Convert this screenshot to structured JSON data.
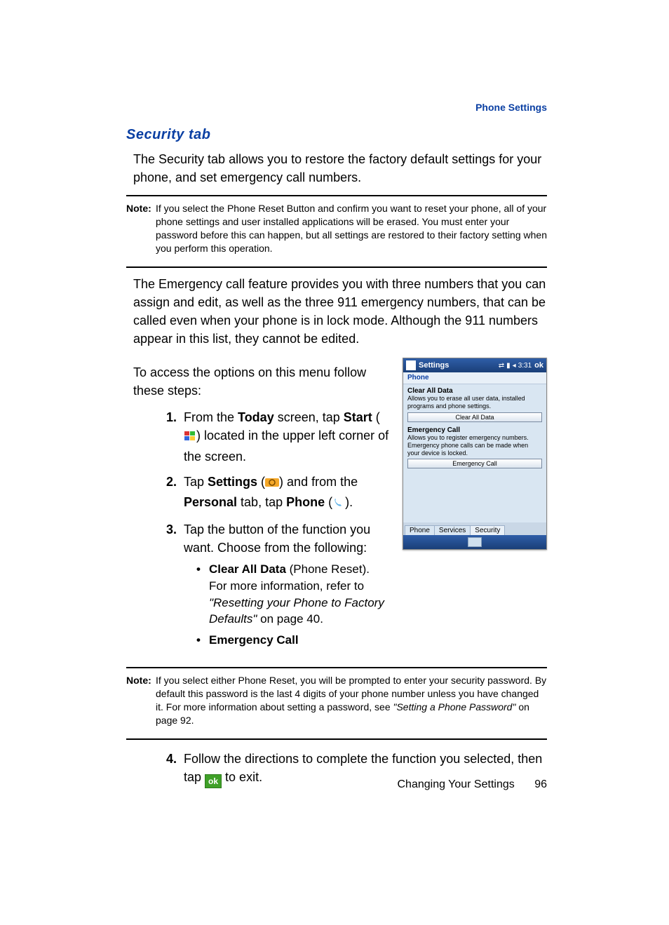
{
  "header": {
    "section": "Phone Settings"
  },
  "heading": "Security tab",
  "intro": "The Security tab allows you to restore the factory default settings for your phone, and set emergency call numbers.",
  "note1": {
    "label": "Note:",
    "text": "If you select the Phone Reset Button and confirm you want to reset your phone, all of your phone settings and user installed applications will be erased. You must enter your password before this can happen, but all settings are restored to their factory setting when you perform this operation."
  },
  "para2": "The Emergency call feature provides you with three numbers that you can assign and edit, as well as the three 911 emergency numbers, that can be called even when your phone is in lock mode. Although the 911 numbers appear in this list, they cannot be edited.",
  "para3": "To access the options on this menu follow these steps:",
  "steps": {
    "s1": {
      "num": "1.",
      "pre": "From the ",
      "b1": "Today",
      "mid1": " screen, tap ",
      "b2": "Start",
      "mid2": " (",
      "post": ") located in the upper left corner of the screen."
    },
    "s2": {
      "num": "2.",
      "pre": "Tap ",
      "b1": "Settings",
      "mid1": " (",
      "mid2": ") and from the ",
      "b2": "Personal",
      "mid3": " tab, tap ",
      "b3": "Phone",
      "mid4": " (",
      "post": ")."
    },
    "s3": {
      "num": "3.",
      "text": "Tap the button of the function you want. Choose from the following:"
    },
    "bullets": {
      "b1": {
        "title": "Clear All Data",
        "after_title": " (Phone Reset). For more information, refer to ",
        "ref": "\"Resetting your Phone to Factory Defaults\"",
        "tail": "  on page 40."
      },
      "b2": {
        "title": "Emergency Call"
      }
    },
    "s4": {
      "num": "4.",
      "pre": "Follow the directions to complete the function you selected, then tap ",
      "ok": "ok",
      "post": " to exit."
    }
  },
  "note2": {
    "label": "Note:",
    "text_pre": "If you select either Phone Reset, you will be prompted to enter your security password. By default this password is the last 4 digits of your phone number unless you have changed it. For more information about setting a password, see ",
    "ref": "\"Setting a Phone Password\"",
    "tail": "  on page 92."
  },
  "device": {
    "title": "Settings",
    "time": "3:31",
    "ok": "ok",
    "sub": "Phone",
    "sec1_title": "Clear All Data",
    "sec1_desc": "Allows you to erase all user data, installed programs and phone settings.",
    "btn1": "Clear All Data",
    "sec2_title": "Emergency Call",
    "sec2_desc": "Allows you to register emergency numbers. Emergency phone calls can be made when your device is locked.",
    "btn2": "Emergency Call",
    "tabs": [
      "Phone",
      "Services",
      "Security"
    ]
  },
  "footer": {
    "chapter": "Changing Your Settings",
    "page": "96"
  }
}
